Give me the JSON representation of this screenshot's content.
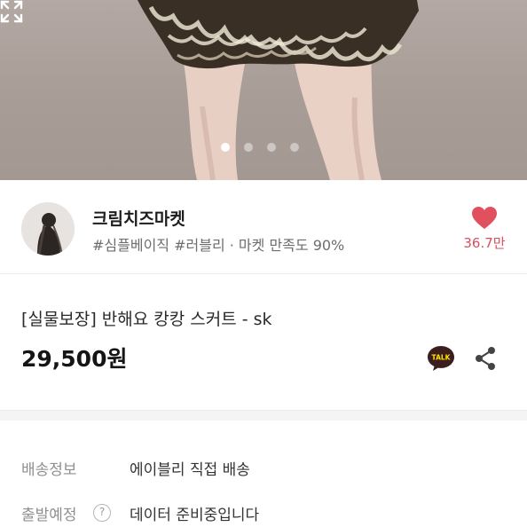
{
  "hero": {
    "slide_count": 4,
    "active_slide": 1,
    "expand_icon": "expand-icon"
  },
  "shop": {
    "name": "크림치즈마켓",
    "tags": "#심플베이직 #러블리 · 마켓 만족도 90%",
    "like_count": "36.7만",
    "like_color": "#e0505f"
  },
  "product": {
    "title": "[실물보장] 반해요 캉캉 스커트 - sk",
    "price": "29,500원",
    "talk_label": "TALK",
    "talk_color": "#3b1e1e",
    "talk_bg": "#fee500"
  },
  "info": {
    "shipping_label": "배송정보",
    "shipping_value": "에이블리 직접 배송",
    "departure_label": "출발예정",
    "departure_help": "?",
    "departure_value": "데이터 준비중입니다"
  }
}
